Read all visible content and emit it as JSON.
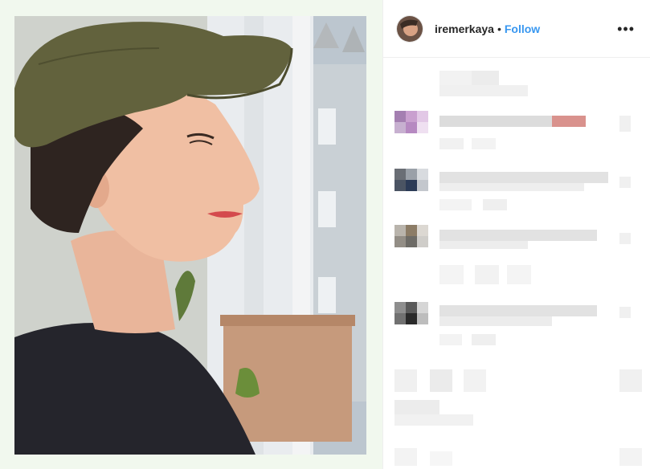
{
  "post": {
    "username": "iremerkaya",
    "separator": "•",
    "follow_label": "Follow",
    "more_icon": "more-options-icon",
    "more_glyph": "•••"
  },
  "photo": {
    "icon": "photo-of-woman-in-cap-at-window"
  },
  "comments": {
    "count_blurred": 6
  },
  "colors": {
    "link": "#3897f0",
    "text": "#262626",
    "border": "#efefef",
    "photo_frame": "#f1f8ee"
  }
}
